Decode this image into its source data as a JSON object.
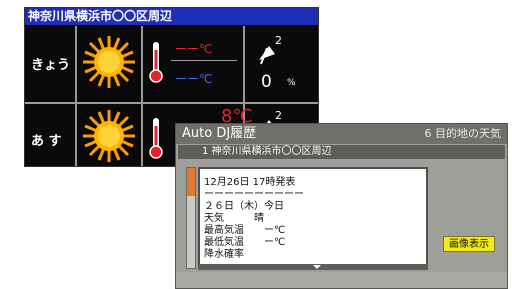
{
  "weather": {
    "title": "神奈川県横浜市〇〇区周辺",
    "today": {
      "label": "きょう",
      "high": "ーー℃",
      "low": "ーー℃",
      "precip_value": "0",
      "precip_unit": "%"
    },
    "tomorrow": {
      "label": "あ す",
      "high": "8℃"
    }
  },
  "dialog": {
    "title": "Auto DJ履歴",
    "title_right": "6 目的地の天気",
    "subtitle": "1 神奈川県横浜市〇〇区周辺",
    "lines": [
      "12月26日 17時発表",
      "ーーーーーーーーーー",
      "２６日（木）今日",
      "天気　　　晴",
      "最高気温　　ー℃",
      "最低気温　　ー℃",
      "降水確率"
    ],
    "button_label": "画像表示"
  },
  "colors": {
    "title_bar": "#1f2fb8",
    "high_temp": "#e8202a",
    "low_temp": "#3a6cf0",
    "button": "#f2ea12",
    "scroll_thumb": "#e07a30"
  }
}
